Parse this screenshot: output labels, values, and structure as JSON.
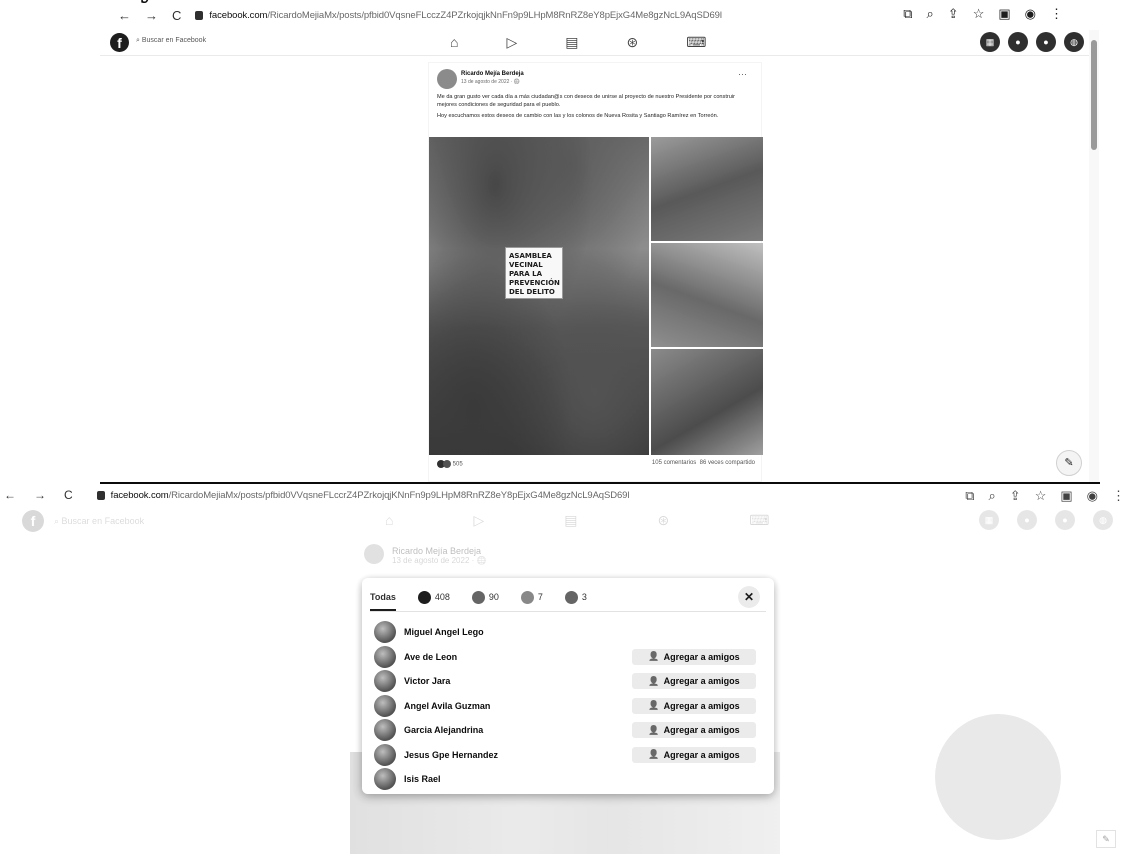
{
  "top_cut_heading": "y",
  "shot1": {
    "url_domain": "facebook.com",
    "url_path": "/RicardoMejiaMx/posts/pfbid0VqsneFLcczZ4PZrkojqjkNnFn9p9LHpM8RnRZ8eY8pEjxG4Me8gzNcL9AqSD69l",
    "search_placeholder": "Buscar en Facebook",
    "post": {
      "author": "Ricardo Mejía Berdeja",
      "date": "13 de agosto de 2022 · 🌐",
      "paragraph1": "Me da gran gusto ver cada día a más ciudadan@s con deseos de unirse al proyecto de nuestro Presidente por construir mejores condiciones de seguridad para el pueblo.",
      "paragraph2": "Hoy escuchamos estos deseos de cambio con las y los colonos de Nueva Rosita y Santiago Ramírez en Torreón.",
      "banner_text": "ASAMBLEA VECINAL PARA LA PREVENCIÓN DEL DELITO",
      "reaction_count": "505",
      "comments": "105 comentarios",
      "shares": "86 veces compartido"
    }
  },
  "shot2": {
    "url_domain": "facebook.com",
    "url_path": "/RicardoMejiaMx/posts/pfbid0VVqsneFLccrZ4PZrkojqjKNnFn9p9LHpM8RnRZ8eY8pEjxG4Me8gzNcL9AqSD69l",
    "search_placeholder": "Buscar en Facebook",
    "ghost_author": "Ricardo Mejía Berdeja",
    "ghost_date": "13 de agosto de 2022 · 🌐",
    "modal": {
      "tabs": [
        {
          "label": "Todas",
          "count": ""
        },
        {
          "label": "",
          "count": "408"
        },
        {
          "label": "",
          "count": "90"
        },
        {
          "label": "",
          "count": "7"
        },
        {
          "label": "",
          "count": "3"
        }
      ],
      "close_label": "✕",
      "add_friend_label": "Agregar a amigos",
      "people": [
        {
          "name": "Miguel Angel Lego",
          "has_button": false
        },
        {
          "name": "Ave de Leon",
          "has_button": true
        },
        {
          "name": "Victor Jara",
          "has_button": true
        },
        {
          "name": "Angel Avila Guzman",
          "has_button": true
        },
        {
          "name": "Garcia Alejandrina",
          "has_button": true
        },
        {
          "name": "Jesus Gpe Hernandez",
          "has_button": true
        },
        {
          "name": "Isis Rael",
          "has_button": false
        }
      ]
    }
  }
}
